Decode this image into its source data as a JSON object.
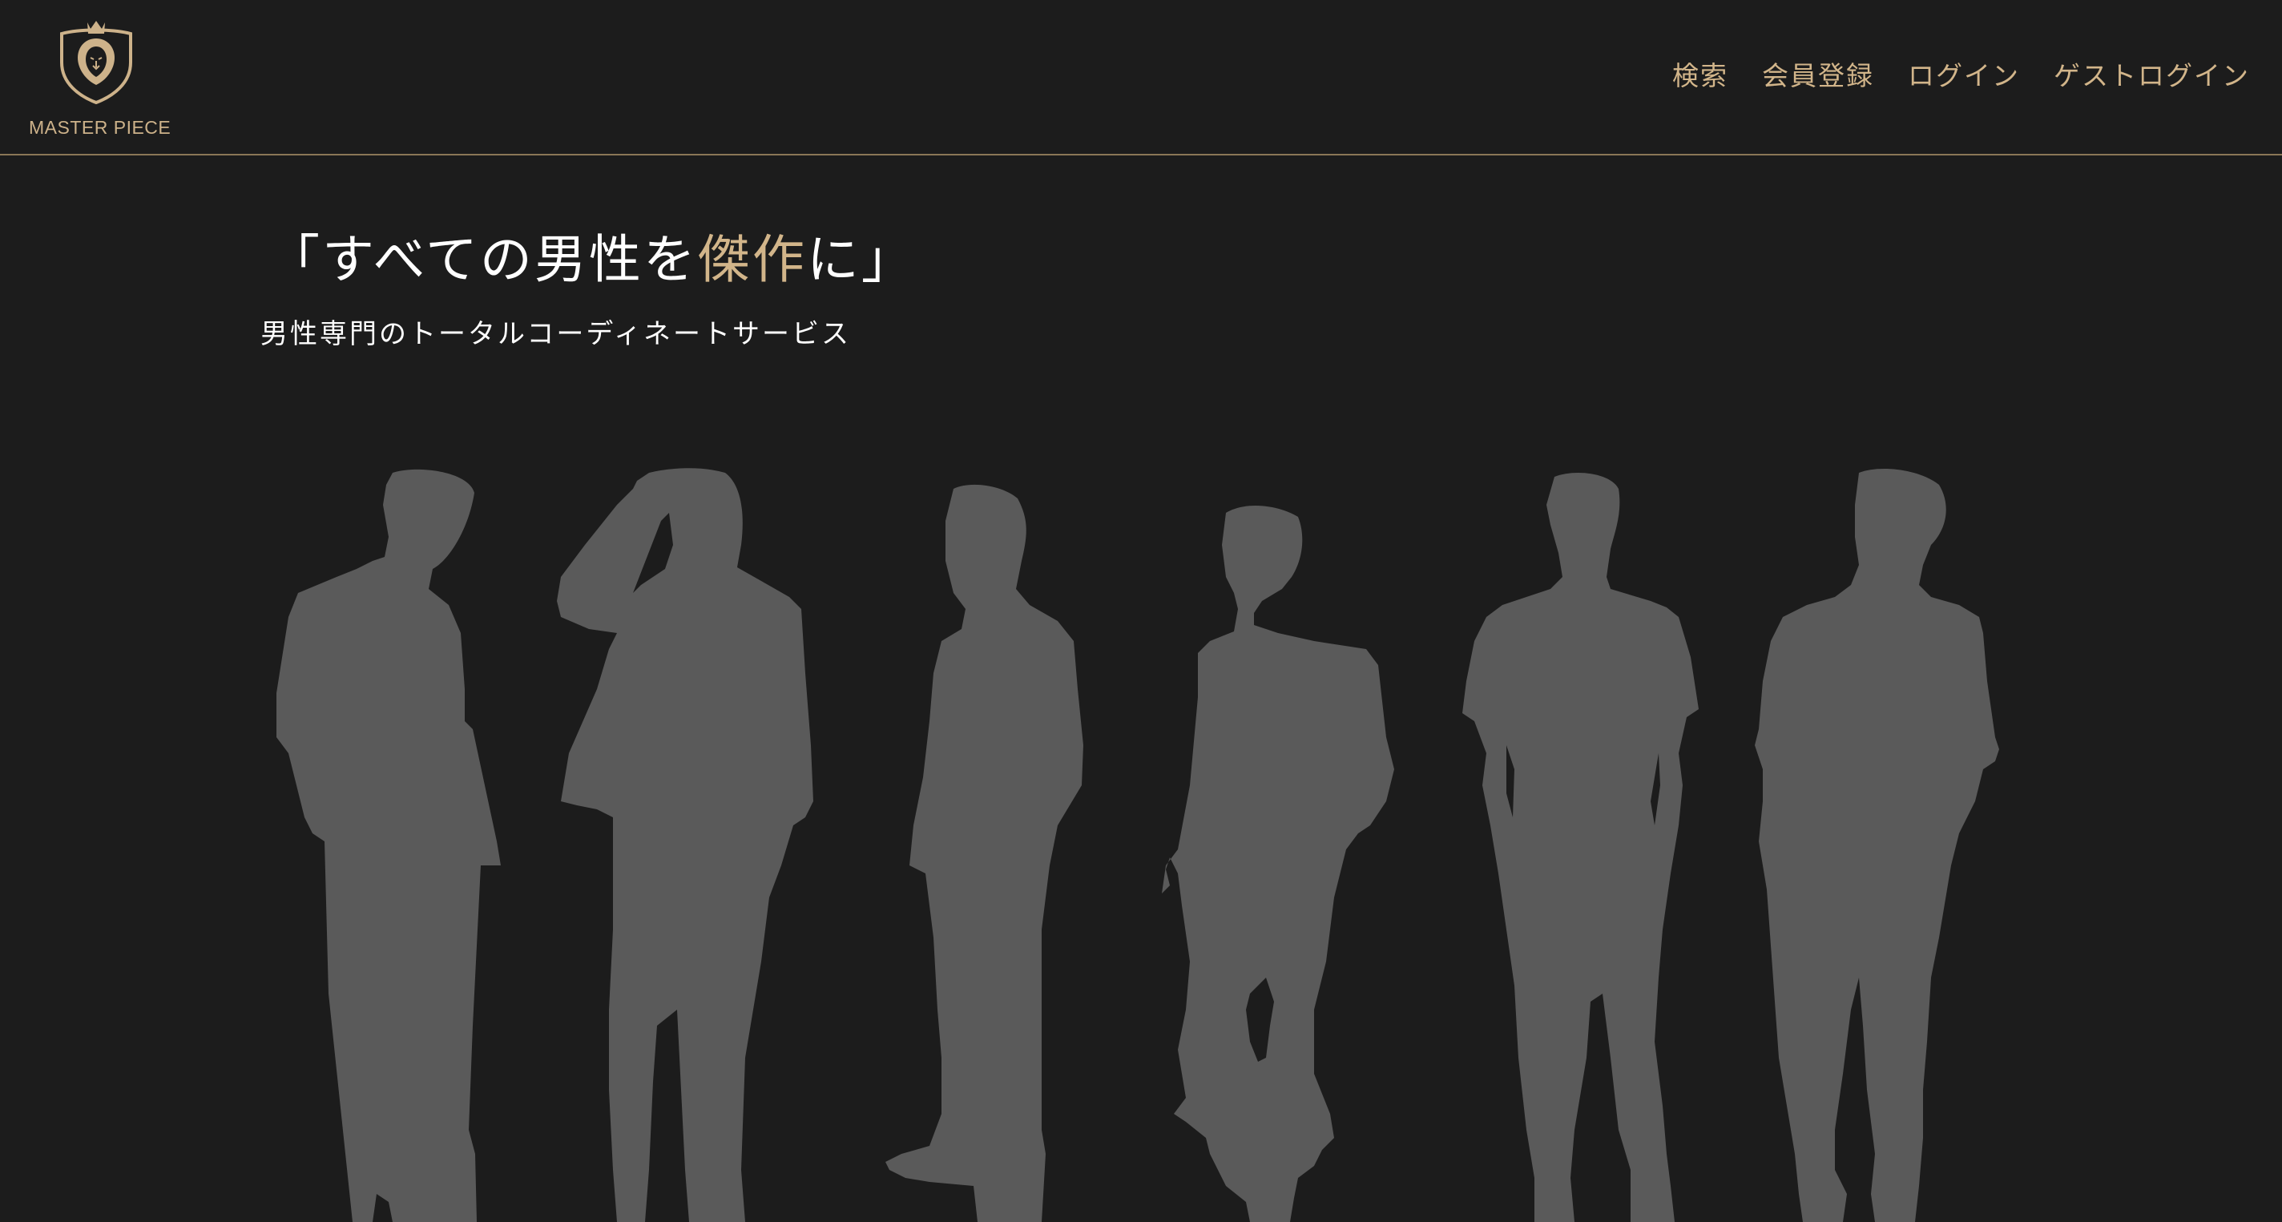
{
  "brand": {
    "name": "MASTER PIECE",
    "logo_icon": "lion-crest-icon",
    "color": "#d2b58a"
  },
  "nav": {
    "items": [
      {
        "label": "検索"
      },
      {
        "label": "会員登録"
      },
      {
        "label": "ログイン"
      },
      {
        "label": "ゲストログイン"
      }
    ]
  },
  "hero": {
    "title_before": "「すべての男性を",
    "title_highlight": "傑作",
    "title_after": "に」",
    "subtitle": "男性専門のトータルコーディネートサービス",
    "image_icon": "men-silhouettes-illustration"
  },
  "colors": {
    "background": "#1c1c1c",
    "accent": "#d2b58a",
    "silhouette": "#5a5a5a",
    "divider": "#8a7656"
  }
}
